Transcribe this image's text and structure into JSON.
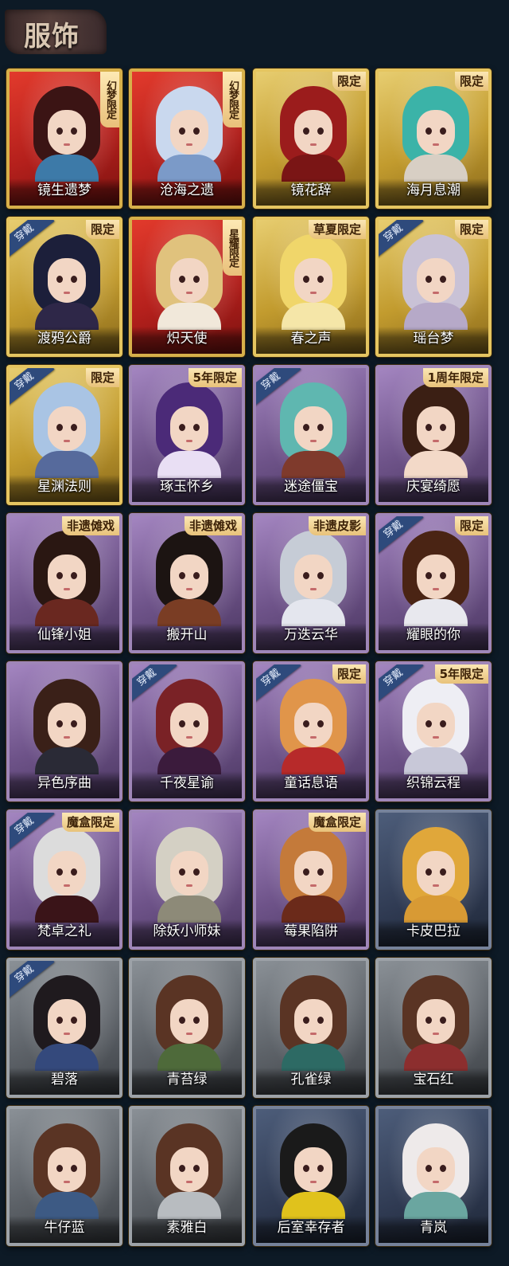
{
  "header": {
    "title": "服饰"
  },
  "badges": {
    "wearing": "穿戴"
  },
  "cards": [
    {
      "name": "镜生遗梦",
      "frame": "red",
      "tag": "幻梦限定",
      "tag_style": "vertical",
      "wearing": false,
      "hair": "#3b1414",
      "outfit": "#3d7aa8"
    },
    {
      "name": "沧海之遗",
      "frame": "red",
      "tag": "幻梦限定",
      "tag_style": "vertical",
      "wearing": false,
      "hair": "#c9d8ee",
      "outfit": "#7b9ac8"
    },
    {
      "name": "镜花辞",
      "frame": "gold",
      "tag": "限定",
      "tag_style": "corner",
      "wearing": false,
      "hair": "#9b1c1c",
      "outfit": "#7a1515"
    },
    {
      "name": "海月息潮",
      "frame": "gold",
      "tag": "限定",
      "tag_style": "corner",
      "wearing": false,
      "hair": "#3bb3a8",
      "outfit": "#d8cfc4"
    },
    {
      "name": "渡鸦公爵",
      "frame": "gold",
      "tag": "限定",
      "tag_style": "corner",
      "wearing": true,
      "hair": "#1c1f3a",
      "outfit": "#2e2748"
    },
    {
      "name": "炽天使",
      "frame": "red",
      "tag": "星耀限定",
      "tag_style": "vertical",
      "wearing": false,
      "hair": "#e0c27d",
      "outfit": "#f1e8da"
    },
    {
      "name": "春之声",
      "frame": "gold",
      "tag": "草夏限定",
      "tag_style": "corner",
      "wearing": false,
      "hair": "#f0d66a",
      "outfit": "#f5e6a8"
    },
    {
      "name": "瑶台梦",
      "frame": "gold",
      "tag": "限定",
      "tag_style": "corner",
      "wearing": true,
      "hair": "#c9c2d6",
      "outfit": "#b6a9c8"
    },
    {
      "name": "星渊法则",
      "frame": "gold",
      "tag": "限定",
      "tag_style": "corner",
      "wearing": true,
      "hair": "#a9c4e4",
      "outfit": "#566a9c"
    },
    {
      "name": "琢玉怀乡",
      "frame": "purple",
      "tag": "5年限定",
      "tag_style": "corner",
      "wearing": false,
      "hair": "#4b2a78",
      "outfit": "#e9dff4"
    },
    {
      "name": "迷途僵宝",
      "frame": "purple",
      "tag": "",
      "tag_style": "none",
      "wearing": true,
      "hair": "#5fb7b0",
      "outfit": "#7f3a2c"
    },
    {
      "name": "庆宴绮愿",
      "frame": "purple",
      "tag": "1周年限定",
      "tag_style": "corner",
      "wearing": false,
      "hair": "#3b1f14",
      "outfit": "#f3d9c8"
    },
    {
      "name": "仙锋小姐",
      "frame": "purple",
      "tag": "非遗傩戏",
      "tag_style": "corner",
      "wearing": false,
      "hair": "#2a1712",
      "outfit": "#6a2820"
    },
    {
      "name": "搬开山",
      "frame": "purple",
      "tag": "非遗傩戏",
      "tag_style": "corner",
      "wearing": false,
      "hair": "#1c1412",
      "outfit": "#7a3d24"
    },
    {
      "name": "万迭云华",
      "frame": "purple",
      "tag": "非遗皮影",
      "tag_style": "corner",
      "wearing": false,
      "hair": "#c6ccd6",
      "outfit": "#e4e6ee"
    },
    {
      "name": "耀眼的你",
      "frame": "purple",
      "tag": "限定",
      "tag_style": "corner",
      "wearing": true,
      "hair": "#4a2414",
      "outfit": "#e8e8ee"
    },
    {
      "name": "异色序曲",
      "frame": "purple",
      "tag": "",
      "tag_style": "none",
      "wearing": false,
      "hair": "#3a2018",
      "outfit": "#2a2a36"
    },
    {
      "name": "千夜星谕",
      "frame": "purple",
      "tag": "",
      "tag_style": "none",
      "wearing": true,
      "hair": "#7a2226",
      "outfit": "#3b1b3c"
    },
    {
      "name": "童话息语",
      "frame": "purple",
      "tag": "限定",
      "tag_style": "corner",
      "wearing": true,
      "hair": "#e0954a",
      "outfit": "#b72a2a"
    },
    {
      "name": "织锦云程",
      "frame": "purple",
      "tag": "5年限定",
      "tag_style": "corner",
      "wearing": true,
      "hair": "#eeeef4",
      "outfit": "#c8c8d8"
    },
    {
      "name": "梵卓之礼",
      "frame": "purple",
      "tag": "魔盒限定",
      "tag_style": "corner",
      "wearing": true,
      "hair": "#dcdcdc",
      "outfit": "#3a1418"
    },
    {
      "name": "除妖小师妹",
      "frame": "purple",
      "tag": "",
      "tag_style": "none",
      "wearing": false,
      "hair": "#d4d0c4",
      "outfit": "#8d8a78"
    },
    {
      "name": "莓果陷阱",
      "frame": "purple",
      "tag": "魔盒限定",
      "tag_style": "corner",
      "wearing": false,
      "hair": "#c47a3a",
      "outfit": "#6b2a1a"
    },
    {
      "name": "卡皮巴拉",
      "frame": "blue",
      "tag": "",
      "tag_style": "none",
      "wearing": false,
      "hair": "#e0a73a",
      "outfit": "#d89a34"
    },
    {
      "name": "碧落",
      "frame": "gray",
      "tag": "",
      "tag_style": "none",
      "wearing": true,
      "hair": "#1f1a1e",
      "outfit": "#34497c"
    },
    {
      "name": "青苔绿",
      "frame": "gray",
      "tag": "",
      "tag_style": "none",
      "wearing": false,
      "hair": "#5a3424",
      "outfit": "#4e6a3a"
    },
    {
      "name": "孔雀绿",
      "frame": "gray",
      "tag": "",
      "tag_style": "none",
      "wearing": false,
      "hair": "#5a3424",
      "outfit": "#2d6a64"
    },
    {
      "name": "宝石红",
      "frame": "gray",
      "tag": "",
      "tag_style": "none",
      "wearing": false,
      "hair": "#5a3424",
      "outfit": "#8c2e2e"
    },
    {
      "name": "牛仔蓝",
      "frame": "gray",
      "tag": "",
      "tag_style": "none",
      "wearing": false,
      "hair": "#5a3424",
      "outfit": "#3d5a84"
    },
    {
      "name": "素雅白",
      "frame": "gray",
      "tag": "",
      "tag_style": "none",
      "wearing": false,
      "hair": "#5a3424",
      "outfit": "#b8bcc0"
    },
    {
      "name": "后室幸存者",
      "frame": "blue",
      "tag": "",
      "tag_style": "none",
      "wearing": false,
      "hair": "#1a1a1a",
      "outfit": "#e0c21c"
    },
    {
      "name": "青岚",
      "frame": "blue",
      "tag": "",
      "tag_style": "none",
      "wearing": false,
      "hair": "#eeeaea",
      "outfit": "#6aa6a0"
    }
  ]
}
